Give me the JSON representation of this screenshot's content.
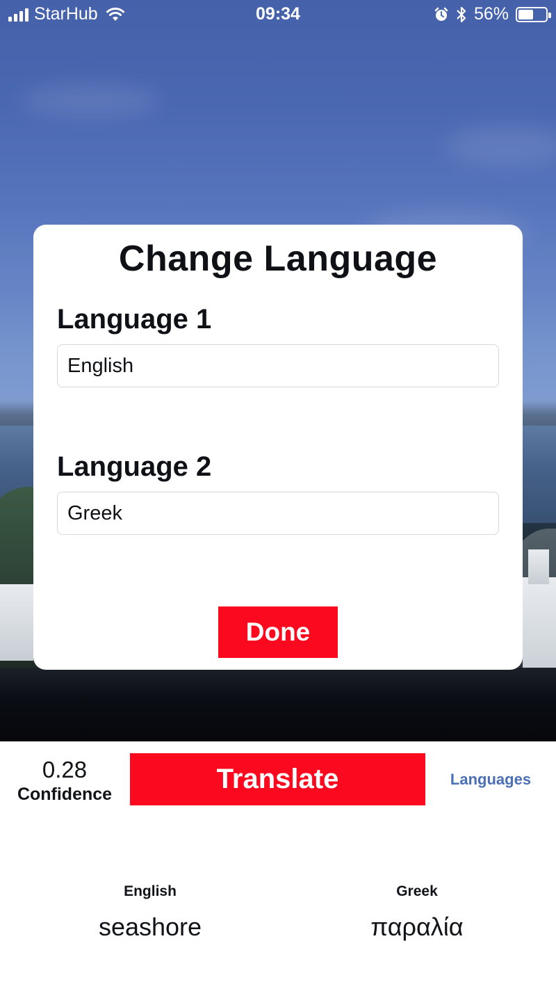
{
  "status_bar": {
    "carrier": "StarHub",
    "time": "09:34",
    "battery_percent": "56%",
    "battery_level": 0.56,
    "icons": [
      "signal-bars-icon",
      "wifi-icon",
      "alarm-icon",
      "bluetooth-icon",
      "battery-icon"
    ]
  },
  "modal": {
    "title": "Change Language",
    "language1": {
      "label": "Language 1",
      "value": "English"
    },
    "language2": {
      "label": "Language 2",
      "value": "Greek"
    },
    "done_label": "Done"
  },
  "controls": {
    "confidence_value": "0.28",
    "confidence_label": "Confidence",
    "translate_label": "Translate",
    "languages_label": "Languages"
  },
  "result": {
    "left": {
      "language": "English",
      "word": "seashore"
    },
    "right": {
      "language": "Greek",
      "word": "παραλία"
    }
  },
  "colors": {
    "accent_red": "#fb0a1f",
    "link_blue": "#4a6fb6"
  }
}
